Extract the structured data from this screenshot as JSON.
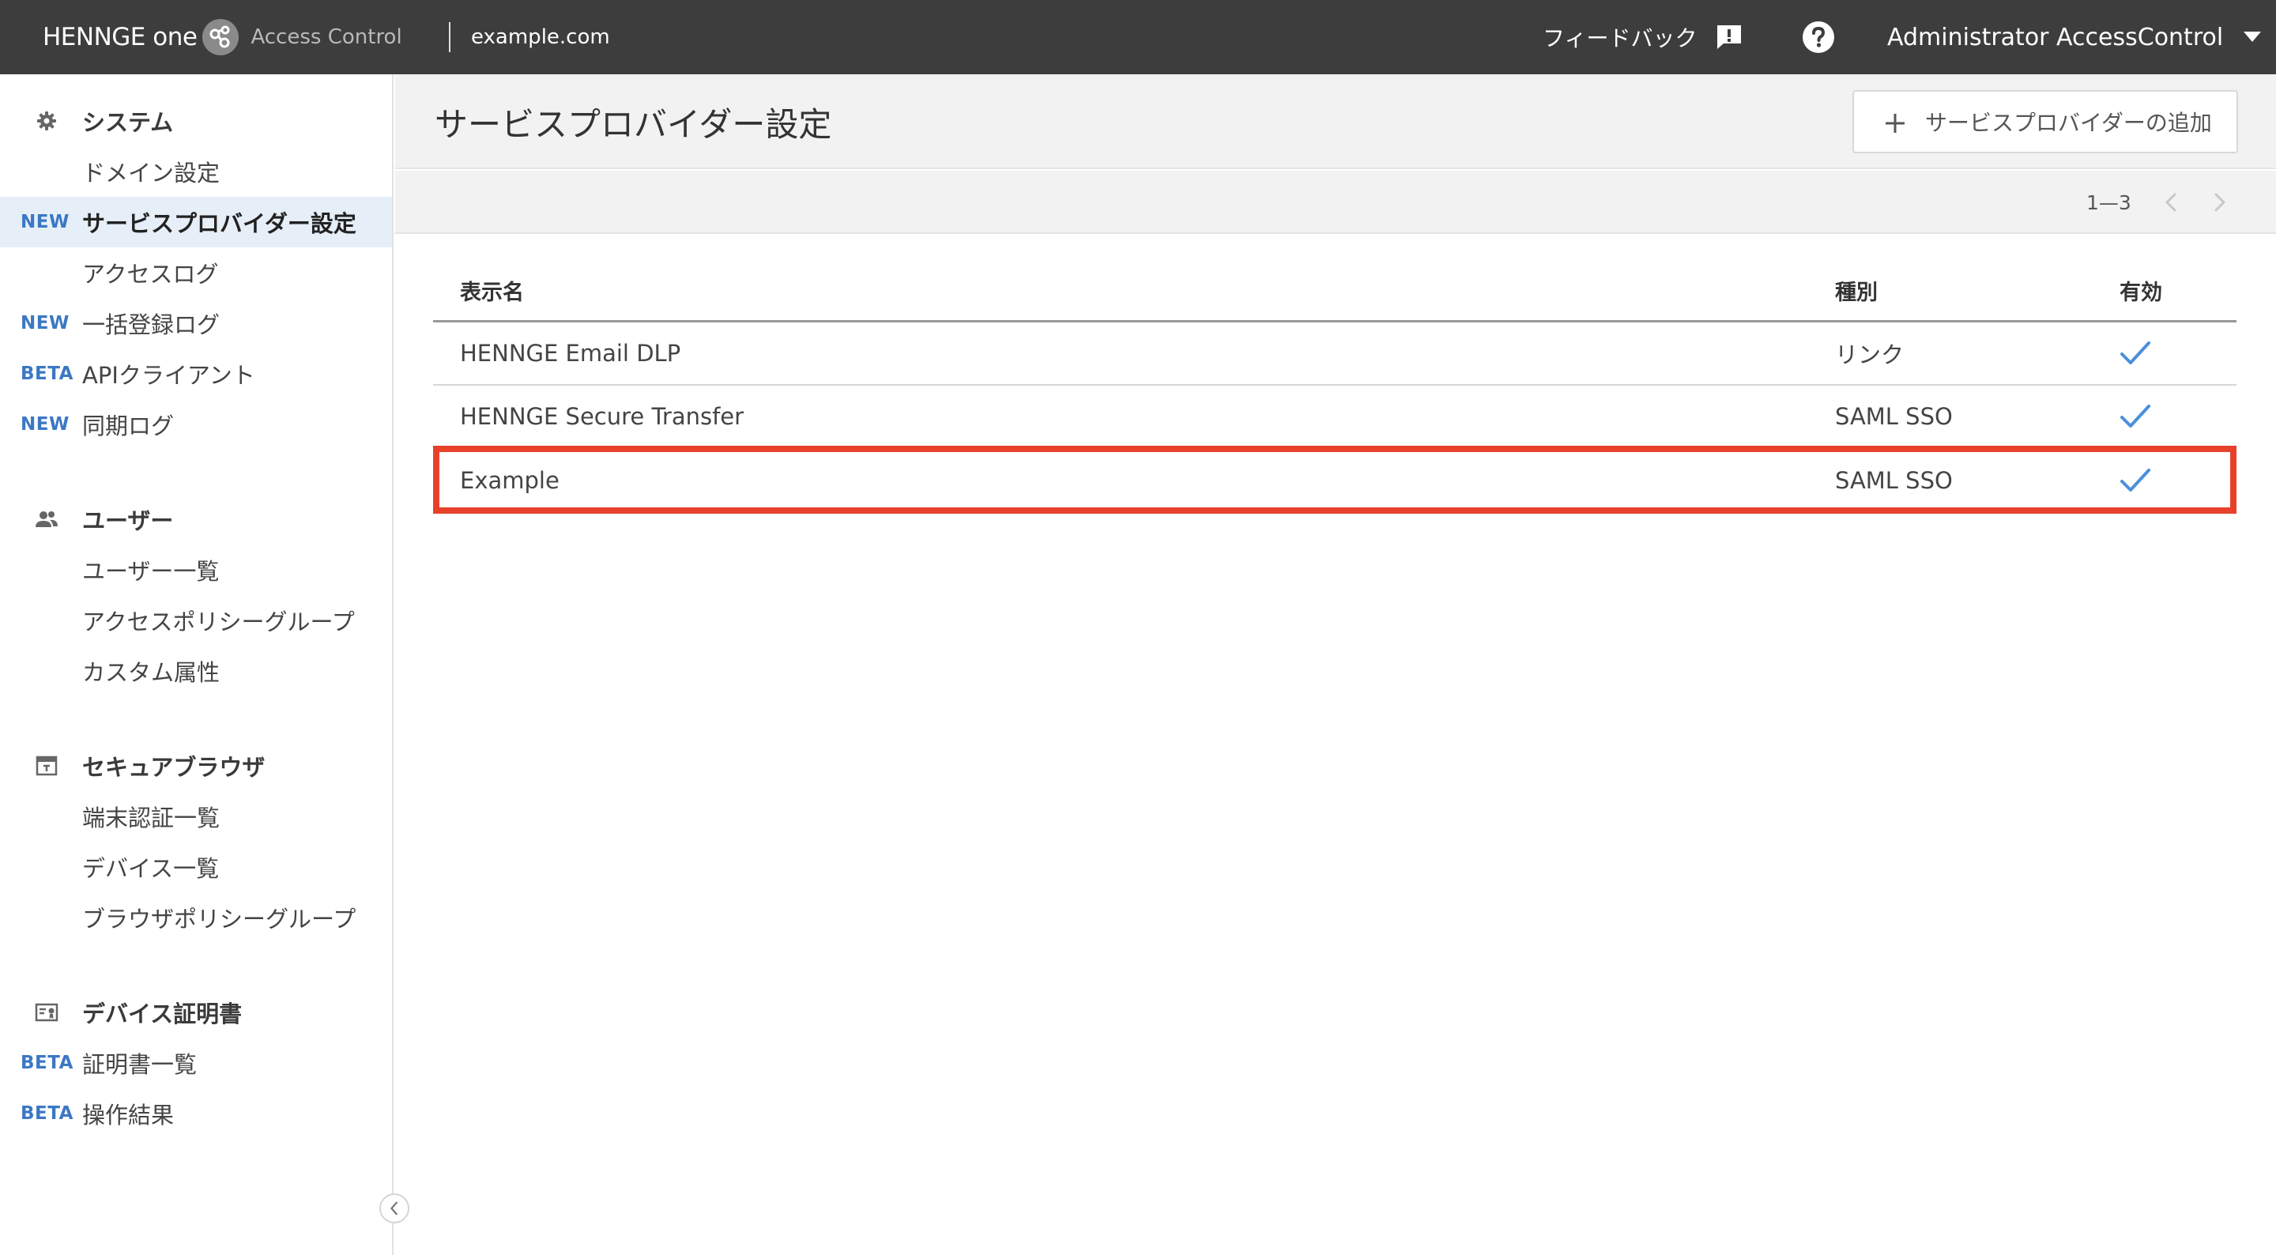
{
  "topbar": {
    "brand": "HENNGE one",
    "product": "Access Control",
    "domain": "example.com",
    "feedback_label": "フィードバック",
    "feedback_icon": "feedback-icon",
    "help_icon": "help-icon",
    "user_name": "Administrator AccessControl",
    "user_menu_icon": "caret-down-icon"
  },
  "sidebar": {
    "sections": [
      {
        "title": "システム",
        "icon": "gear-icon",
        "items": [
          {
            "badge": "",
            "label": "ドメイン設定"
          },
          {
            "badge": "NEW",
            "label": "サービスプロバイダー設定",
            "active": true
          },
          {
            "badge": "",
            "label": "アクセスログ"
          },
          {
            "badge": "NEW",
            "label": "一括登録ログ"
          },
          {
            "badge": "BETA",
            "label": "APIクライアント"
          },
          {
            "badge": "NEW",
            "label": "同期ログ"
          }
        ]
      },
      {
        "title": "ユーザー",
        "icon": "users-icon",
        "items": [
          {
            "badge": "",
            "label": "ユーザー一覧"
          },
          {
            "badge": "",
            "label": "アクセスポリシーグループ"
          },
          {
            "badge": "",
            "label": "カスタム属性"
          }
        ]
      },
      {
        "title": "セキュアブラウザ",
        "icon": "browser-icon",
        "items": [
          {
            "badge": "",
            "label": "端末認証一覧"
          },
          {
            "badge": "",
            "label": "デバイス一覧"
          },
          {
            "badge": "",
            "label": "ブラウザポリシーグループ"
          }
        ]
      },
      {
        "title": "デバイス証明書",
        "icon": "certificate-icon",
        "items": [
          {
            "badge": "BETA",
            "label": "証明書一覧"
          },
          {
            "badge": "BETA",
            "label": "操作結果"
          }
        ]
      }
    ],
    "collapse_icon": "chevron-left-icon"
  },
  "main": {
    "title": "サービスプロバイダー設定",
    "add_button": "サービスプロバイダーの追加",
    "pager": {
      "range": "1—3"
    },
    "table": {
      "columns": [
        "表示名",
        "種別",
        "有効"
      ],
      "rows": [
        {
          "name": "HENNGE Email DLP",
          "type": "リンク",
          "enabled": true
        },
        {
          "name": "HENNGE Secure Transfer",
          "type": "SAML SSO",
          "enabled": true
        },
        {
          "name": "Example",
          "type": "SAML SSO",
          "enabled": true,
          "highlighted": true
        }
      ]
    }
  },
  "colors": {
    "topbar_bg": "#3d3d3d",
    "accent_blue": "#3b78c4",
    "check_blue": "#4a8fdc",
    "highlight_red": "#e8412b",
    "active_item_bg": "#e6eef8"
  }
}
